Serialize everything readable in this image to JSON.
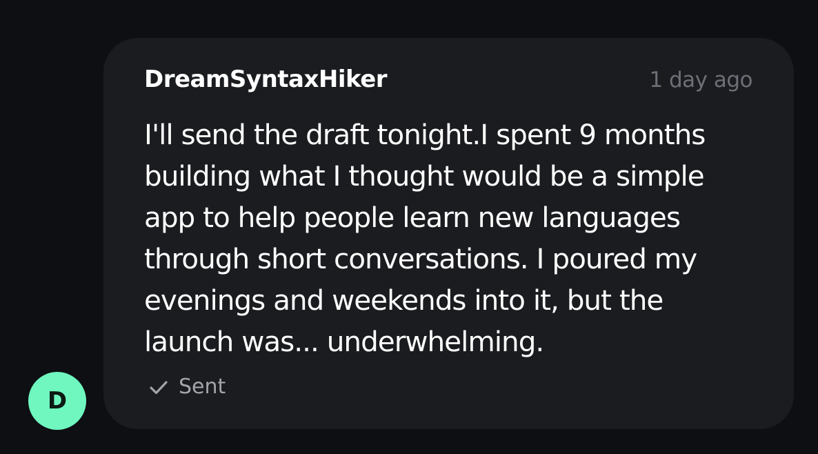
{
  "message": {
    "author": "DreamSyntaxHiker",
    "timestamp": "1 day ago",
    "text": "I'll send the draft tonight.I spent 9 months building what I thought would be a simple app to help people learn new languages through short conversations. I poured my evenings and weekends into it, but the launch was... underwhelming.",
    "status": {
      "icon": "check-icon",
      "label": "Sent"
    }
  },
  "avatar": {
    "initial": "D",
    "color": "#6ff7bf"
  },
  "colors": {
    "background": "#0d0f12",
    "bubble": "#1b1c20",
    "timestamp": "#6d6f76",
    "status": "#a3a5ab"
  }
}
